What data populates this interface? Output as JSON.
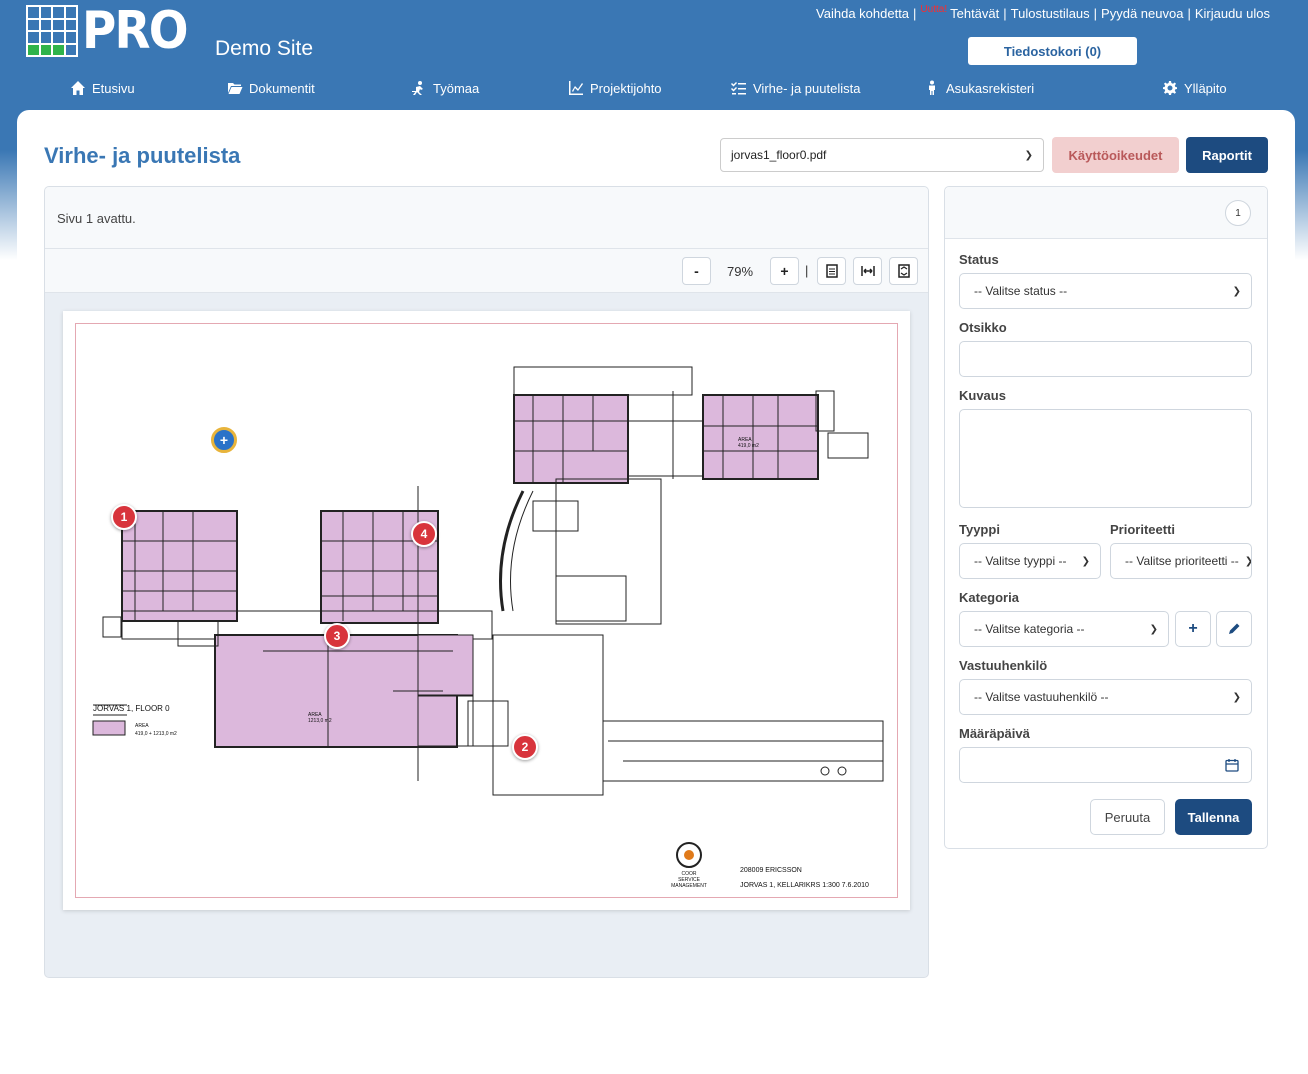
{
  "header": {
    "logo_text": "PRO",
    "site_title": "Demo Site",
    "links": [
      "Vaihda kohdetta",
      "Tehtävät",
      "Tulostustilaus",
      "Pyydä neuvoa",
      "Kirjaudu ulos"
    ],
    "new_badge": "Uutta!",
    "cart_button": "Tiedostokori (0)"
  },
  "nav": [
    {
      "label": "Etusivu",
      "icon": "home-icon"
    },
    {
      "label": "Dokumentit",
      "icon": "folder-icon"
    },
    {
      "label": "Työmaa",
      "icon": "worker-icon"
    },
    {
      "label": "Projektijohto",
      "icon": "chart-icon"
    },
    {
      "label": "Virhe- ja puutelista",
      "icon": "checklist-icon"
    },
    {
      "label": "Asukasrekisteri",
      "icon": "person-icon"
    },
    {
      "label": "Ylläpito",
      "icon": "gear-icon"
    }
  ],
  "page": {
    "title": "Virhe- ja puutelista",
    "file_selected": "jorvas1_floor0.pdf",
    "permissions_button": "Käyttöoikeudet",
    "reports_button": "Raportit"
  },
  "viewer": {
    "status_message": "Sivu 1 avattu.",
    "zoom_out": "-",
    "zoom_level": "79%",
    "zoom_in": "+",
    "separator": "|",
    "plan": {
      "title_label": "JORVAS 1, FLOOR 0",
      "legend_area": "AREA",
      "legend_value": "419,0 + 1213,0 m2",
      "area_label_1": "AREA",
      "area_value_1": "419,0 m2",
      "area_label_2": "AREA",
      "area_value_2": "1213,0 m2",
      "project_code": "208009  ERICSSON",
      "project_line": "JORVAS 1, KELLARIKRS 1:300  7.6.2010",
      "company_line1": "COOR",
      "company_line2": "SERVICE",
      "company_line3": "MANAGEMENT"
    },
    "markers": [
      "1",
      "2",
      "3",
      "4"
    ],
    "add_marker": "+"
  },
  "form": {
    "page_number": "1",
    "status_label": "Status",
    "status_value": "-- Valitse status --",
    "title_label": "Otsikko",
    "description_label": "Kuvaus",
    "type_label": "Tyyppi",
    "type_value": "-- Valitse tyyppi --",
    "priority_label": "Prioriteetti",
    "priority_value": "-- Valitse prioriteetti --",
    "category_label": "Kategoria",
    "category_value": "-- Valitse kategoria --",
    "add_category": "+",
    "responsible_label": "Vastuuhenkilö",
    "responsible_value": "-- Valitse vastuuhenkilö --",
    "due_label": "Määräpäivä",
    "cancel_button": "Peruuta",
    "save_button": "Tallenna"
  },
  "colors": {
    "brand_blue": "#3a77b4",
    "dark_blue": "#1d4b80",
    "marker_red": "#d8343c",
    "room_fill": "#dcb8dc"
  }
}
